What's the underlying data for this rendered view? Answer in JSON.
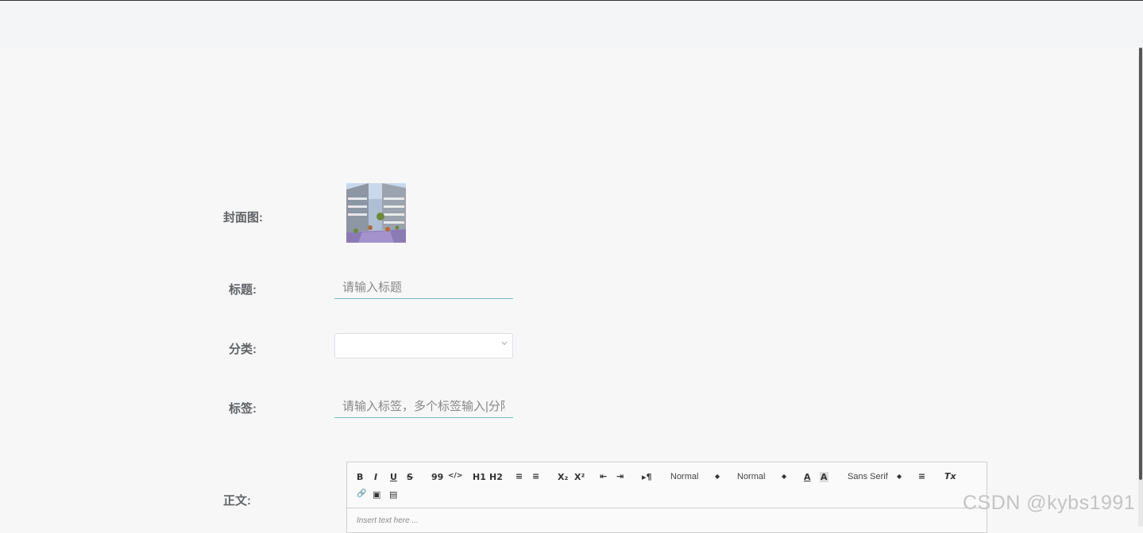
{
  "form": {
    "cover_label": "封面图:",
    "title_label": "标题:",
    "title_placeholder": "请输入标题",
    "category_label": "分类:",
    "category_value": "",
    "tags_label": "标签:",
    "tags_placeholder": "请输入标签，多个标签输入|分隔",
    "body_label": "正文:"
  },
  "editor": {
    "toolbar": {
      "bold": "B",
      "italic": "I",
      "underline": "U",
      "strike": "S",
      "blockquote": "99",
      "code": "</>",
      "h1": "H1",
      "h2": "H2",
      "ordered_list": "≡",
      "bullet_list": "≡",
      "subscript": "X₂",
      "superscript": "X²",
      "outdent": "⇤",
      "indent": "⇥",
      "direction": "▸¶",
      "size_select": "Normal",
      "header_select": "Normal",
      "color": "A",
      "background": "A",
      "font_select": "Sans Serif",
      "align": "≡",
      "clean": "Tx",
      "link": "🔗",
      "image": "▣",
      "video": "▤"
    },
    "placeholder": "Insert text here ..."
  },
  "watermark": "CSDN @kybs1991"
}
